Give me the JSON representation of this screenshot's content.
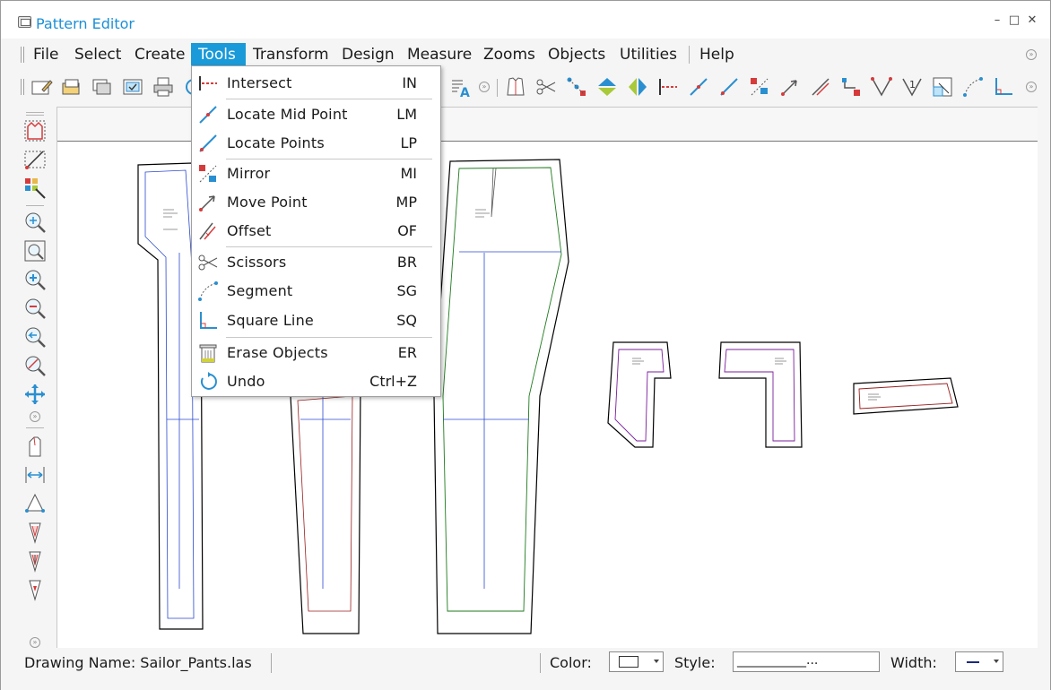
{
  "window": {
    "title": "Pattern Editor",
    "controls": [
      "–",
      "□",
      "✕"
    ]
  },
  "menubar": {
    "items": [
      "File",
      "Select",
      "Create",
      "Tools",
      "Transform",
      "Design",
      "Measure",
      "Zooms",
      "Objects",
      "Utilities",
      "Help"
    ],
    "active": "Tools"
  },
  "tools_menu": [
    {
      "label": "Intersect",
      "shortcut": "IN",
      "icon": "intersect-icon"
    },
    {
      "label": "Locate Mid Point",
      "shortcut": "LM",
      "icon": "locate-mid-point-icon"
    },
    {
      "label": "Locate Points",
      "shortcut": "LP",
      "icon": "locate-points-icon"
    },
    {
      "label": "Mirror",
      "shortcut": "MI",
      "icon": "mirror-icon"
    },
    {
      "label": "Move Point",
      "shortcut": "MP",
      "icon": "move-point-icon"
    },
    {
      "label": "Offset",
      "shortcut": "OF",
      "icon": "offset-icon"
    },
    {
      "label": "Scissors",
      "shortcut": "BR",
      "icon": "scissors-icon"
    },
    {
      "label": "Segment",
      "shortcut": "SG",
      "icon": "segment-icon"
    },
    {
      "label": "Square Line",
      "shortcut": "SQ",
      "icon": "square-line-icon"
    },
    {
      "label": "Erase Objects",
      "shortcut": "ER",
      "icon": "erase-icon"
    },
    {
      "label": "Undo",
      "shortcut": "Ctrl+Z",
      "icon": "undo-icon"
    }
  ],
  "statusbar": {
    "drawing_name": "Drawing Name: Sailor_Pants.las",
    "color_label": "Color:",
    "style_label": "Style:",
    "style_value": "___________...",
    "width_label": "Width:"
  },
  "colors": {
    "accent": "#1a9ad9",
    "title": "#1c8fd6",
    "pattern_green": "#1e7a1e",
    "pattern_purple": "#7a1e9a",
    "pattern_red": "#9a1e1e",
    "grain_blue": "#2a4ad0"
  }
}
